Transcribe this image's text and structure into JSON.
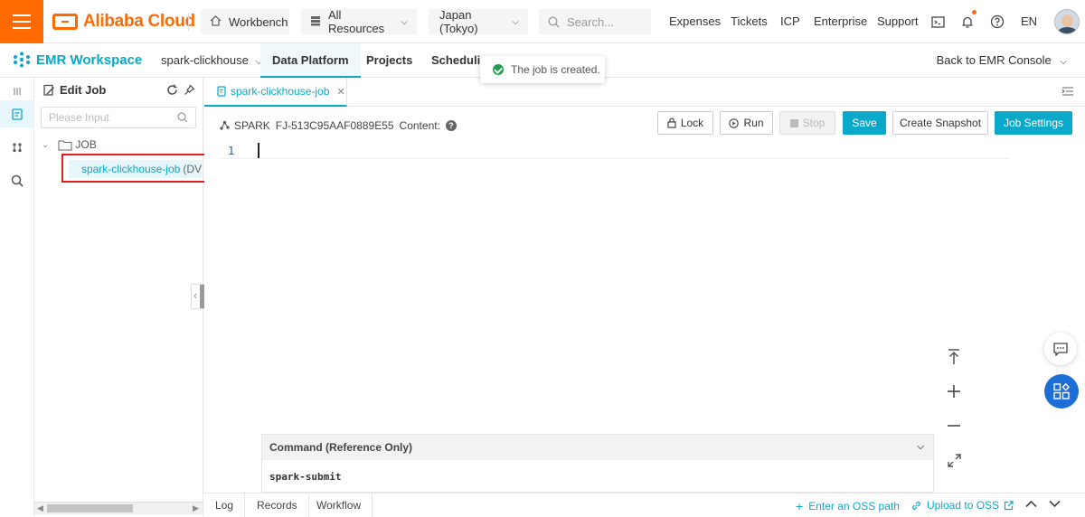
{
  "topbar": {
    "brand": "Alibaba Cloud",
    "workbench": "Workbench",
    "resources": "All Resources",
    "region": "Japan (Tokyo)",
    "search_placeholder": "Search...",
    "links": [
      "Expenses",
      "Tickets",
      "ICP",
      "Enterprise",
      "Support"
    ],
    "language": "EN",
    "accent_color": "#ff6a00"
  },
  "subnav": {
    "product": "EMR Workspace",
    "cluster": "spark-clickhouse",
    "tabs": [
      "Data Platform",
      "Projects",
      "Scheduling"
    ],
    "active_tab": "Data Platform",
    "back_link": "Back to EMR Console",
    "accent_color": "#0aa8c9"
  },
  "toast": {
    "message": "The job is created."
  },
  "tree": {
    "title": "Edit Job",
    "search_placeholder": "Please Input",
    "folder": "JOB",
    "job_name": "spark-clickhouse-job",
    "job_suffix": "(DV"
  },
  "editor": {
    "tab_label": "spark-clickhouse-job",
    "job_type": "SPARK",
    "job_id": "FJ-513C95AAF0889E55",
    "content_label": "Content:",
    "line_number": "1",
    "buttons": {
      "lock": "Lock",
      "run": "Run",
      "stop": "Stop",
      "save": "Save",
      "snapshot": "Create Snapshot",
      "settings": "Job Settings"
    }
  },
  "command": {
    "title": "Command (Reference Only)",
    "body": "spark-submit"
  },
  "bottom": {
    "tabs": [
      "Log",
      "Records",
      "Workflow"
    ],
    "enter_oss": "Enter an OSS path",
    "upload_oss": "Upload to OSS"
  }
}
